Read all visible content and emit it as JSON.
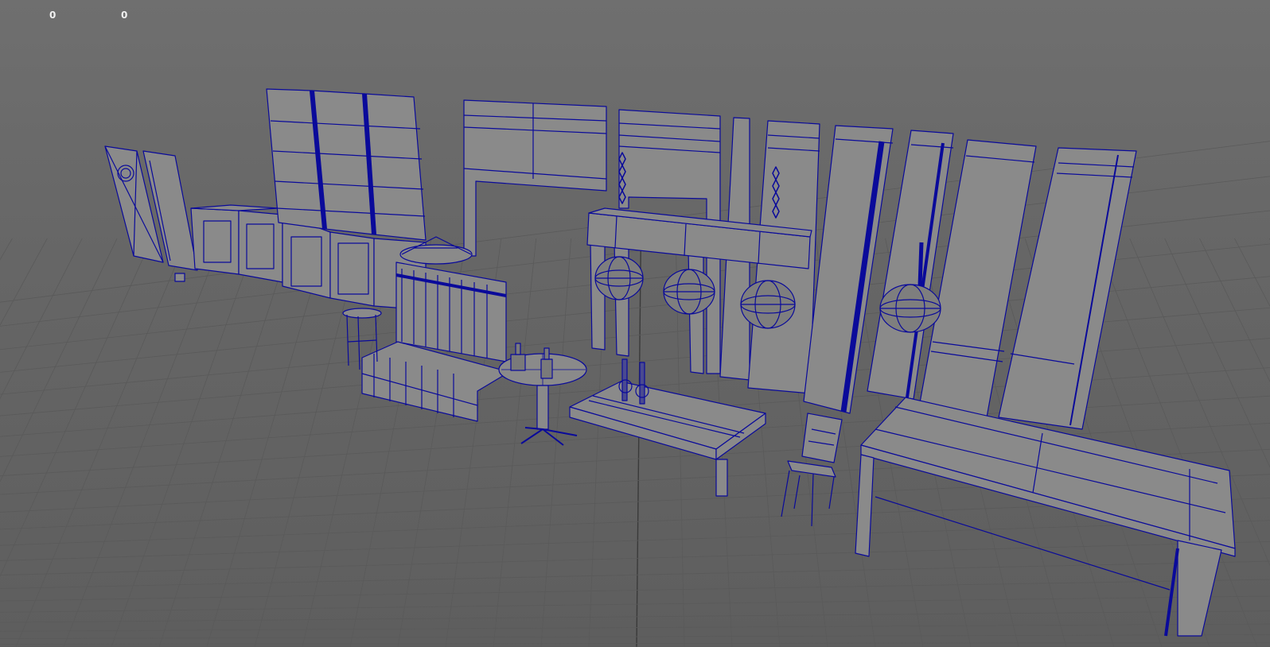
{
  "viewport": {
    "hud": {
      "value_a": "0",
      "value_b": "0"
    },
    "colors": {
      "background": "#6b6b6b",
      "grid": "#5a5a5a",
      "grid_axis": "#3a3a3a",
      "wire": "#0a0a9a",
      "surface": "#8a8a8a",
      "surface_dark": "#7a7a7a",
      "hud_text": "#f0f0f0"
    }
  }
}
